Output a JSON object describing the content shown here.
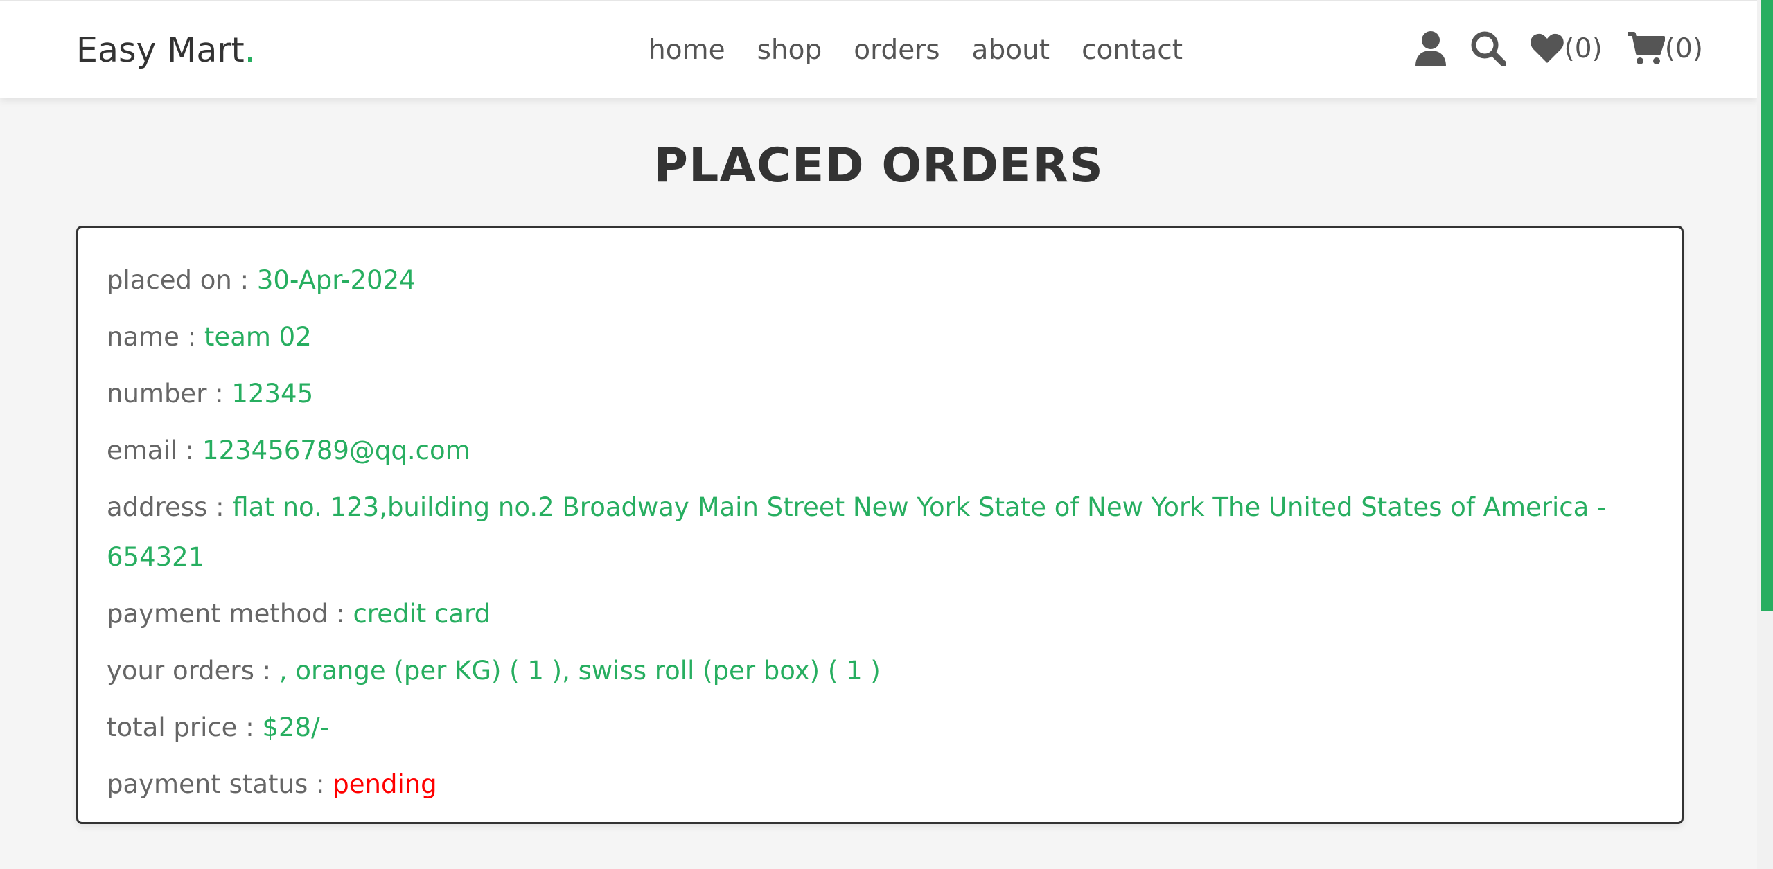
{
  "header": {
    "logo_text": "Easy Mart",
    "logo_dot": ".",
    "nav": [
      {
        "label": "home"
      },
      {
        "label": "shop"
      },
      {
        "label": "orders"
      },
      {
        "label": "about"
      },
      {
        "label": "contact"
      }
    ],
    "wishlist_count": "(0)",
    "cart_count": "(0)",
    "icons": [
      "user-icon",
      "search-icon",
      "heart-icon",
      "cart-icon"
    ]
  },
  "page": {
    "title": "PLACED ORDERS"
  },
  "order": {
    "placed_on_label": "placed on : ",
    "placed_on": "30-Apr-2024",
    "name_label": "name : ",
    "name": "team 02",
    "number_label": "number : ",
    "number": "12345",
    "email_label": "email : ",
    "email": "123456789@qq.com",
    "address_label": "address : ",
    "address": "flat no. 123,building no.2 Broadway Main Street New York State of New York The United States of America - 654321",
    "payment_method_label": "payment method : ",
    "payment_method": "credit card",
    "orders_label": "your orders : ",
    "orders": ", orange (per KG) ( 1 ), swiss roll (per box) ( 1 )",
    "total_label": "total price : ",
    "total": "$28/-",
    "status_label": "payment status : ",
    "status": "pending"
  },
  "colors": {
    "accent": "#27ae60",
    "pending": "#ff0000",
    "text_dark": "#333333",
    "text_muted": "#666666"
  }
}
